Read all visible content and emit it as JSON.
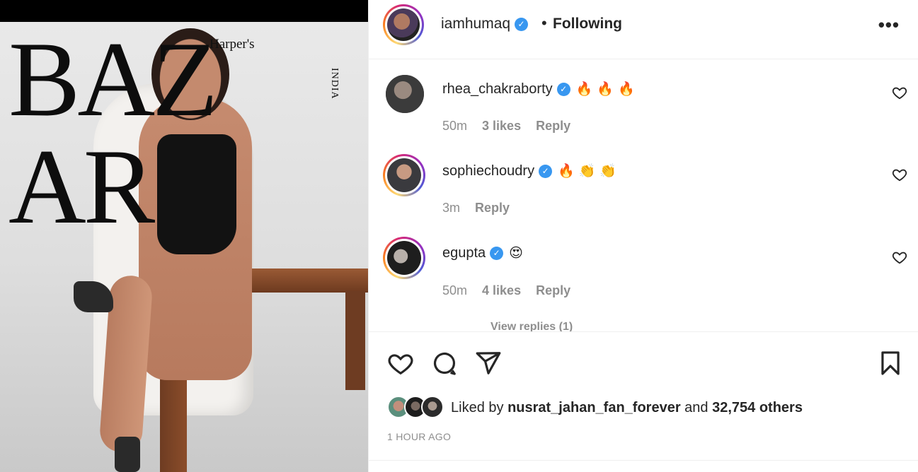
{
  "photo": {
    "masthead": "BAZ AR",
    "brand_small": "Harper's",
    "edition": "INDIA"
  },
  "post": {
    "author": "iamhumaq",
    "follow_status": "Following",
    "separator": "•",
    "more_label": "•••",
    "verified_mark": "✓"
  },
  "comments": [
    {
      "user": "rhea_chakraborty",
      "verified": true,
      "text": "🔥🔥🔥",
      "time": "50m",
      "likes": "3 likes",
      "reply": "Reply"
    },
    {
      "user": "sophiechoudry",
      "verified": true,
      "text": "🔥👏👏",
      "time": "3m",
      "likes": "",
      "reply": "Reply"
    },
    {
      "user": "egupta",
      "verified": true,
      "text": "😍",
      "time": "50m",
      "likes": "4 likes",
      "reply": "Reply"
    }
  ],
  "view_replies": "View replies (1)",
  "likes": {
    "prefix": "Liked by",
    "user": "nusrat_jahan_fan_forever",
    "conjunction": "and",
    "others": "32,754 others"
  },
  "timestamp": "1 HOUR AGO",
  "icons": {
    "like": "heart-icon",
    "comment": "comment-icon",
    "share": "share-icon",
    "save": "bookmark-icon",
    "more": "more-icon"
  },
  "colors": {
    "verified": "#3897f0",
    "secondary_text": "#8e8e8e",
    "primary_text": "#262626"
  }
}
